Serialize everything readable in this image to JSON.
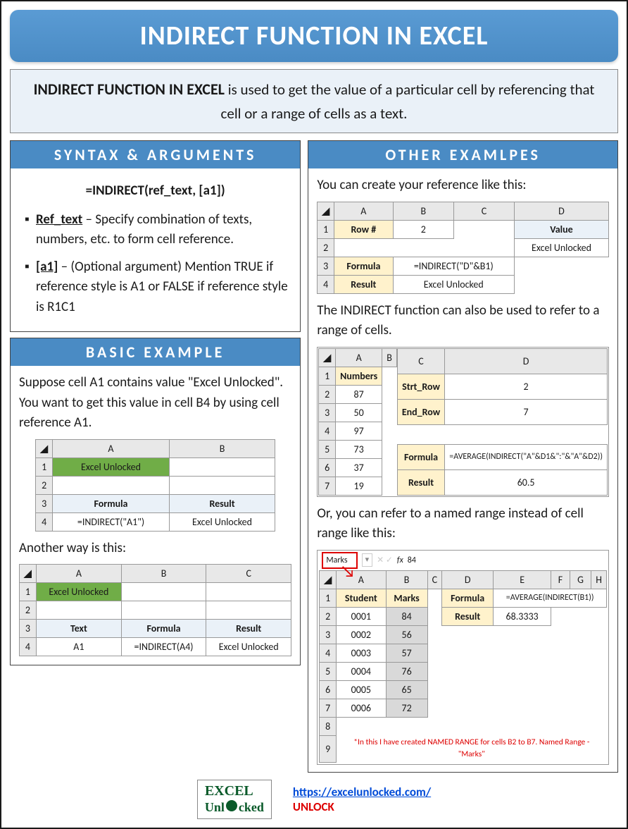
{
  "title": "INDIRECT FUNCTION IN EXCEL",
  "desc_bold": "INDIRECT FUNCTION IN EXCEL",
  "desc_rest": " is used to get the value of a particular cell by referencing that cell or a range of cells as a text.",
  "syntax": {
    "header": "SYNTAX & ARGUMENTS",
    "formula": "=INDIRECT(ref_text, [a1])",
    "args": [
      {
        "name": "Ref_text",
        "text": " – Specify combination of texts, numbers, etc. to form cell reference."
      },
      {
        "name": "[a1]",
        "text": " – (Optional argument) Mention TRUE if reference style is A1 or FALSE if reference style is R1C1"
      }
    ]
  },
  "basic": {
    "header": "BASIC EXAMPLE",
    "intro": "Suppose cell A1 contains value \"Excel Unlocked\". You want to get this value in cell B4 by using cell reference A1.",
    "t1": {
      "cols": [
        "A",
        "B"
      ],
      "r1a": "Excel Unlocked",
      "r3a": "Formula",
      "r3b": "Result",
      "r4a": "=INDIRECT(\"A1\")",
      "r4b": "Excel Unlocked"
    },
    "mid": "Another way is this:",
    "t2": {
      "cols": [
        "A",
        "B",
        "C"
      ],
      "r1a": "Excel Unlocked",
      "r3a": "Text",
      "r3b": "Formula",
      "r3c": "Result",
      "r4a": "A1",
      "r4b": "=INDIRECT(A4)",
      "r4c": "Excel Unlocked"
    }
  },
  "other": {
    "header": "OTHER EXAMLPES",
    "p1": "You can create your reference like this:",
    "t1": {
      "cols": [
        "A",
        "B",
        "C",
        "D"
      ],
      "rownum_lab": "Row #",
      "rownum_val": "2",
      "value_lab": "Value",
      "value_val": "Excel Unlocked",
      "formula_lab": "Formula",
      "formula_val": "=INDIRECT(\"D\"&B1)",
      "result_lab": "Result",
      "result_val": "Excel Unlocked"
    },
    "p2": "The INDIRECT function can also be used to refer to a range of cells.",
    "t2": {
      "colsAB": [
        "A",
        "B"
      ],
      "colsCD": [
        "C",
        "D"
      ],
      "numbers_hdr": "Numbers",
      "numbers": [
        "87",
        "50",
        "97",
        "73",
        "37",
        "19"
      ],
      "strt_lab": "Strt_Row",
      "strt_val": "2",
      "end_lab": "End_Row",
      "end_val": "7",
      "formula_lab": "Formula",
      "formula_val": "=AVERAGE(INDIRECT(\"A\"&D1&\":\"&\"A\"&D2))",
      "result_lab": "Result",
      "result_val": "60.5"
    },
    "p3": "Or, you can refer to a named range instead of cell range like this:",
    "t3": {
      "marks_name": "Marks",
      "fx_val": "84",
      "cols": [
        "A",
        "B",
        "C",
        "D",
        "E",
        "F",
        "G",
        "H"
      ],
      "student_hdr": "Student",
      "marks_hdr": "Marks",
      "rows": [
        {
          "s": "0001",
          "m": "84"
        },
        {
          "s": "0002",
          "m": "56"
        },
        {
          "s": "0003",
          "m": "57"
        },
        {
          "s": "0004",
          "m": "76"
        },
        {
          "s": "0005",
          "m": "65"
        },
        {
          "s": "0006",
          "m": "72"
        }
      ],
      "formula_lab": "Formula",
      "formula_val": "=AVERAGE(INDIRECT(B1))",
      "result_lab": "Result",
      "result_val": "68.3333",
      "note": "*In this I have created NAMED RANGE for cells B2 to B7. Named Range - \"Marks\""
    }
  },
  "footer": {
    "logo_top": "EXCEL",
    "logo_mid": "Unl  cked",
    "url": "https://excelunlocked.com/",
    "unlock": "UNLOCK"
  }
}
